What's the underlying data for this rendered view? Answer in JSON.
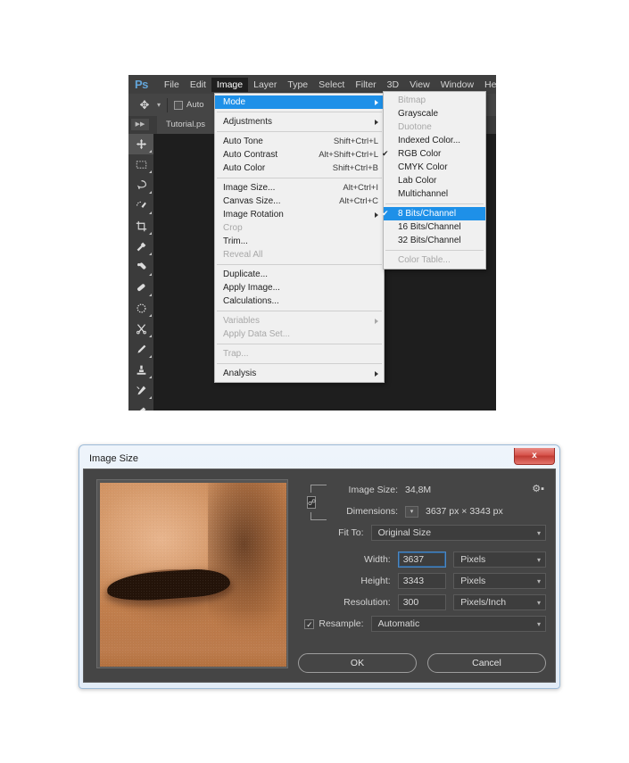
{
  "photoshop": {
    "logo": "Ps",
    "menubar": [
      {
        "label": "File",
        "active": false
      },
      {
        "label": "Edit",
        "active": false
      },
      {
        "label": "Image",
        "active": true
      },
      {
        "label": "Layer",
        "active": false
      },
      {
        "label": "Type",
        "active": false
      },
      {
        "label": "Select",
        "active": false
      },
      {
        "label": "Filter",
        "active": false
      },
      {
        "label": "3D",
        "active": false
      },
      {
        "label": "View",
        "active": false
      },
      {
        "label": "Window",
        "active": false
      },
      {
        "label": "Help",
        "active": false
      }
    ],
    "options_bar": {
      "tool_icon": "move-tool-icon",
      "auto_select_label": "Auto"
    },
    "document_tab": "Tutorial.ps",
    "tools": [
      "move-tool-icon",
      "rectangular-marquee-tool-icon",
      "lasso-tool-icon",
      "quick-selection-tool-icon",
      "crop-tool-icon",
      "eyedropper-tool-icon",
      "spot-healing-brush-tool-icon",
      "brush-tool-icon",
      "patch-tool-icon",
      "clone-stamp-tool-icon",
      "history-brush-tool-icon",
      "eraser-tool-icon",
      "gradient-tool-icon",
      "blur-tool-icon"
    ]
  },
  "image_menu": {
    "items": [
      {
        "label": "Mode",
        "shortcut": "",
        "submenu": true,
        "disabled": false,
        "highlighted": true,
        "checked": false
      },
      {
        "separator": true
      },
      {
        "label": "Adjustments",
        "shortcut": "",
        "submenu": true,
        "disabled": false,
        "highlighted": false,
        "checked": false
      },
      {
        "separator": true
      },
      {
        "label": "Auto Tone",
        "shortcut": "Shift+Ctrl+L",
        "submenu": false,
        "disabled": false,
        "highlighted": false,
        "checked": false
      },
      {
        "label": "Auto Contrast",
        "shortcut": "Alt+Shift+Ctrl+L",
        "submenu": false,
        "disabled": false,
        "highlighted": false,
        "checked": false
      },
      {
        "label": "Auto Color",
        "shortcut": "Shift+Ctrl+B",
        "submenu": false,
        "disabled": false,
        "highlighted": false,
        "checked": false
      },
      {
        "separator": true
      },
      {
        "label": "Image Size...",
        "shortcut": "Alt+Ctrl+I",
        "submenu": false,
        "disabled": false,
        "highlighted": false,
        "checked": false
      },
      {
        "label": "Canvas Size...",
        "shortcut": "Alt+Ctrl+C",
        "submenu": false,
        "disabled": false,
        "highlighted": false,
        "checked": false
      },
      {
        "label": "Image Rotation",
        "shortcut": "",
        "submenu": true,
        "disabled": false,
        "highlighted": false,
        "checked": false
      },
      {
        "label": "Crop",
        "shortcut": "",
        "submenu": false,
        "disabled": true,
        "highlighted": false,
        "checked": false
      },
      {
        "label": "Trim...",
        "shortcut": "",
        "submenu": false,
        "disabled": false,
        "highlighted": false,
        "checked": false
      },
      {
        "label": "Reveal All",
        "shortcut": "",
        "submenu": false,
        "disabled": true,
        "highlighted": false,
        "checked": false
      },
      {
        "separator": true
      },
      {
        "label": "Duplicate...",
        "shortcut": "",
        "submenu": false,
        "disabled": false,
        "highlighted": false,
        "checked": false
      },
      {
        "label": "Apply Image...",
        "shortcut": "",
        "submenu": false,
        "disabled": false,
        "highlighted": false,
        "checked": false
      },
      {
        "label": "Calculations...",
        "shortcut": "",
        "submenu": false,
        "disabled": false,
        "highlighted": false,
        "checked": false
      },
      {
        "separator": true
      },
      {
        "label": "Variables",
        "shortcut": "",
        "submenu": true,
        "disabled": true,
        "highlighted": false,
        "checked": false
      },
      {
        "label": "Apply Data Set...",
        "shortcut": "",
        "submenu": false,
        "disabled": true,
        "highlighted": false,
        "checked": false
      },
      {
        "separator": true
      },
      {
        "label": "Trap...",
        "shortcut": "",
        "submenu": false,
        "disabled": true,
        "highlighted": false,
        "checked": false
      },
      {
        "separator": true
      },
      {
        "label": "Analysis",
        "shortcut": "",
        "submenu": true,
        "disabled": false,
        "highlighted": false,
        "checked": false
      }
    ]
  },
  "mode_submenu": {
    "items": [
      {
        "label": "Bitmap",
        "disabled": true,
        "checked": false,
        "highlighted": false
      },
      {
        "label": "Grayscale",
        "disabled": false,
        "checked": false,
        "highlighted": false
      },
      {
        "label": "Duotone",
        "disabled": true,
        "checked": false,
        "highlighted": false
      },
      {
        "label": "Indexed Color...",
        "disabled": false,
        "checked": false,
        "highlighted": false
      },
      {
        "label": "RGB Color",
        "disabled": false,
        "checked": true,
        "highlighted": false
      },
      {
        "label": "CMYK Color",
        "disabled": false,
        "checked": false,
        "highlighted": false
      },
      {
        "label": "Lab Color",
        "disabled": false,
        "checked": false,
        "highlighted": false
      },
      {
        "label": "Multichannel",
        "disabled": false,
        "checked": false,
        "highlighted": false
      },
      {
        "separator": true
      },
      {
        "label": "8 Bits/Channel",
        "disabled": false,
        "checked": true,
        "highlighted": true
      },
      {
        "label": "16 Bits/Channel",
        "disabled": false,
        "checked": false,
        "highlighted": false
      },
      {
        "label": "32 Bits/Channel",
        "disabled": false,
        "checked": false,
        "highlighted": false
      },
      {
        "separator": true
      },
      {
        "label": "Color Table...",
        "disabled": true,
        "checked": false,
        "highlighted": false
      }
    ]
  },
  "dialog": {
    "title": "Image Size",
    "close_label": "x",
    "gear_icon": "gear-icon",
    "image_size_label": "Image Size:",
    "image_size_value": "34,8M",
    "dimensions_label": "Dimensions:",
    "dimensions_value": "3637 px  ×  3343 px",
    "fit_to_label": "Fit To:",
    "fit_to_value": "Original Size",
    "width_label": "Width:",
    "width_value": "3637",
    "width_unit": "Pixels",
    "height_label": "Height:",
    "height_value": "3343",
    "height_unit": "Pixels",
    "resolution_label": "Resolution:",
    "resolution_value": "300",
    "resolution_unit": "Pixels/Inch",
    "resample_label": "Resample:",
    "resample_value": "Automatic",
    "resample_checked": "✓",
    "link_icon": "chain-link-icon",
    "ok_label": "OK",
    "cancel_label": "Cancel",
    "preview_alt": "nose-closeup-preview"
  },
  "colors": {
    "accent_blue": "#1e90e8",
    "ps_chrome": "#3f3f3f",
    "dialog_body": "#454545",
    "close_red": "#c13b33"
  }
}
